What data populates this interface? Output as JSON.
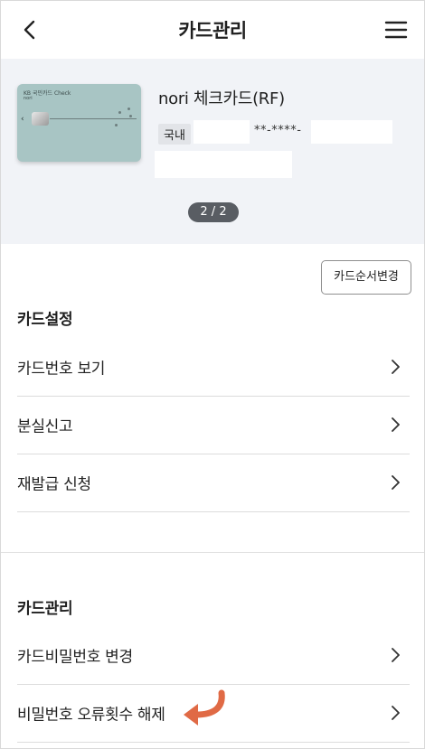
{
  "header": {
    "title": "카드관리",
    "back_icon": "chevron-left-icon",
    "menu_icon": "hamburger-menu-icon"
  },
  "card": {
    "brand": "KB 국민카드  Check",
    "sub_brand": "nori",
    "name": "nori 체크카드(RF)",
    "region_tag": "국내",
    "masked_number": "**-****-",
    "pager": "2 / 2",
    "card_color": "#a8c5c4"
  },
  "reorder_button": "카드순서변경",
  "card_settings": {
    "title": "카드설정",
    "items": [
      {
        "label": "카드번호 보기"
      },
      {
        "label": "분실신고"
      },
      {
        "label": "재발급 신청"
      }
    ]
  },
  "card_management": {
    "title": "카드관리",
    "items": [
      {
        "label": "카드비밀번호 변경"
      },
      {
        "label": "비밀번호 오류횟수 해제"
      }
    ]
  },
  "colors": {
    "card_area_bg": "#f1f3f7",
    "pager_bg": "#595d63",
    "hint_arrow": "#e06a45"
  }
}
